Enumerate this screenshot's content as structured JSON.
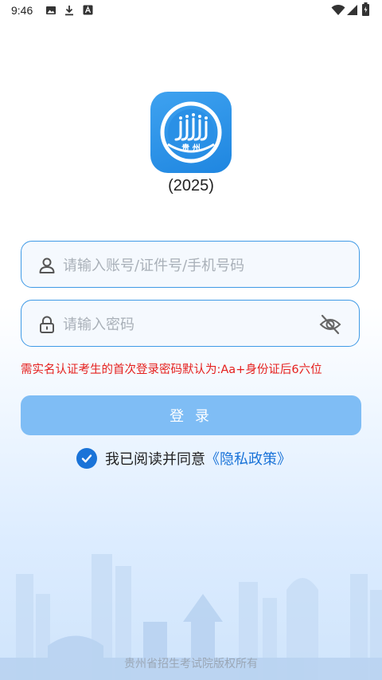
{
  "status_bar": {
    "time": "9:46",
    "left_icons": [
      "image-icon",
      "download-icon",
      "font-icon"
    ],
    "right_icons": [
      "wifi-icon",
      "signal-icon",
      "battery-icon"
    ]
  },
  "header": {
    "logo_text": "贵 州",
    "version": "(2025)"
  },
  "form": {
    "username": {
      "placeholder": "请输入账号/证件号/手机号码",
      "value": "",
      "icon": "user-icon"
    },
    "password": {
      "placeholder": "请输入密码",
      "value": "",
      "icon": "lock-icon",
      "toggle_icon": "eye-off-icon"
    },
    "notice": "需实名认证考生的首次登录密码默认为:Aa+身份证后6六位",
    "login_label": "登 录",
    "agreement": {
      "checked": true,
      "text": "我已阅读并同意",
      "link": "《隐私政策》"
    }
  },
  "footer": {
    "copyright": "贵州省招生考试院版权所有"
  },
  "colors": {
    "accent": "#1a73d8",
    "border": "#3f9ae6",
    "button": "#7fbdf5",
    "warning": "#e5201e"
  }
}
